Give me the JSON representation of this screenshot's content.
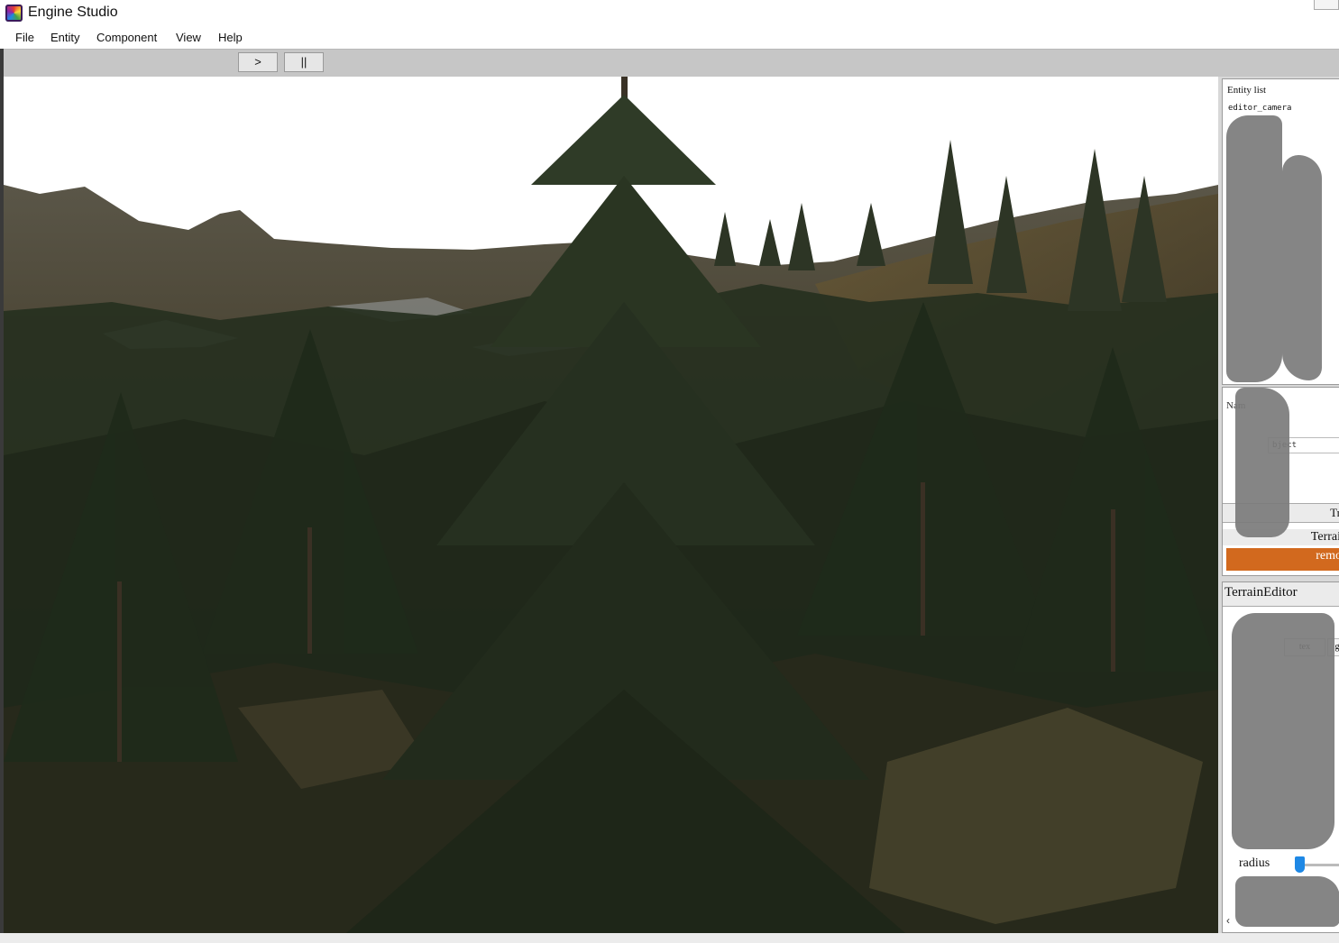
{
  "window": {
    "title": "Engine Studio",
    "icon": "app-icon"
  },
  "menu": [
    "File",
    "Entity",
    "Component",
    "View",
    "Help"
  ],
  "toolbar": {
    "play_label": ">",
    "pause_label": "||"
  },
  "entity_list": {
    "title": "Entity list",
    "items": [
      "editor_camera"
    ]
  },
  "inspector": {
    "name_label": "Nam",
    "object_field": "bject",
    "transform_label": "Tr",
    "component_label": "Terrai",
    "remove_label": "remo",
    "remove_color": "#d2691e"
  },
  "terrain_editor": {
    "title": "TerrainEditor",
    "tabs": [
      "tex",
      "g"
    ],
    "radius_label": "radius",
    "radius_value": 0.05,
    "slider_color": "#1e88e5"
  },
  "colors": {
    "toolbar_bg": "#c6c6c6",
    "sky": "#ffffff",
    "foliage": "#26301f"
  }
}
